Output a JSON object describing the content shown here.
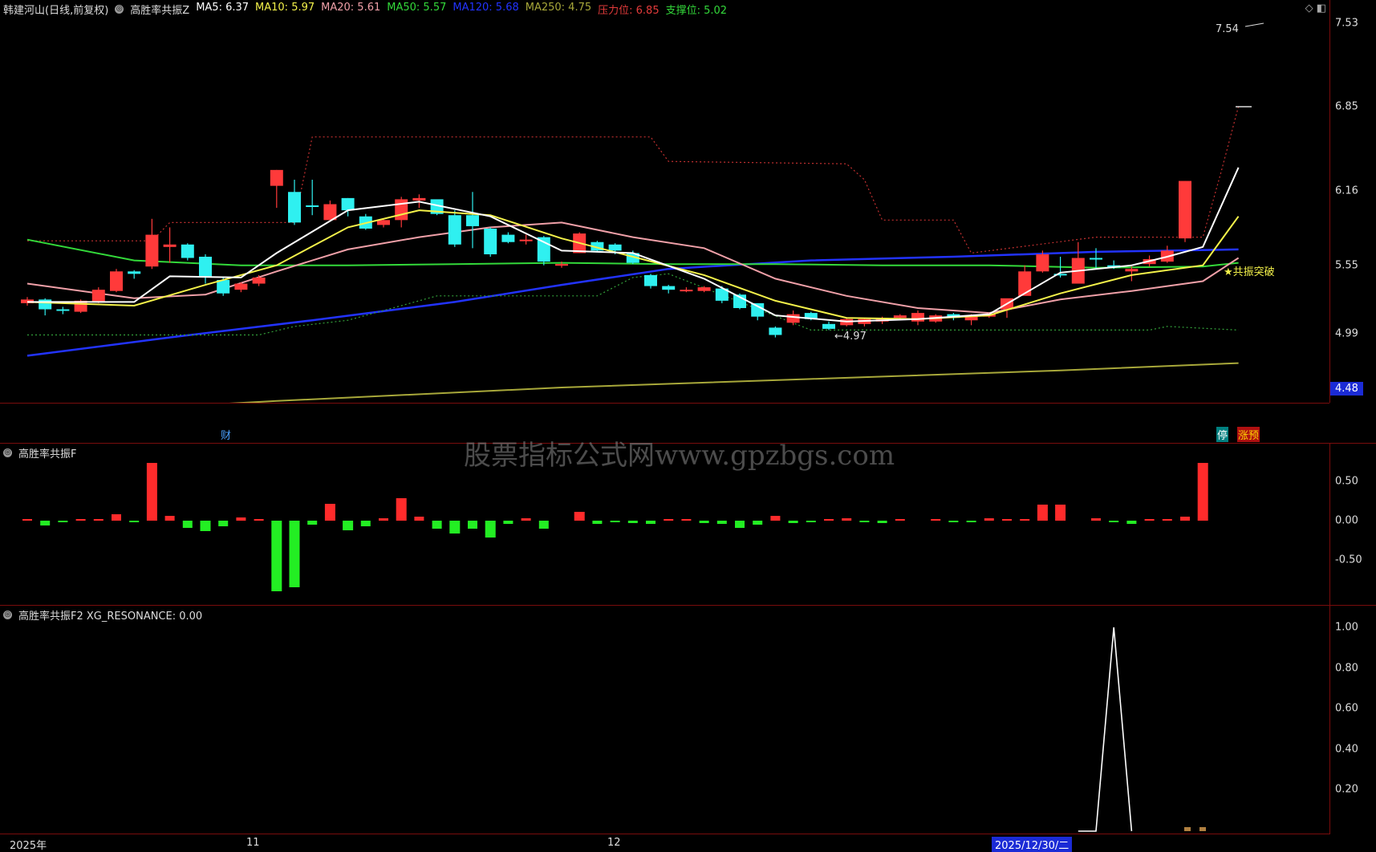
{
  "main_header": {
    "stock": "韩建河山(日线,前复权)",
    "indicator": "高胜率共振Z",
    "items": [
      {
        "label": "MA5: 6.37",
        "color": "#ffffff"
      },
      {
        "label": "MA10: 5.97",
        "color": "#f4f24a"
      },
      {
        "label": "MA20: 5.61",
        "color": "#f0a0a8"
      },
      {
        "label": "MA50: 5.57",
        "color": "#33d93a"
      },
      {
        "label": "MA120: 5.68",
        "color": "#2233ff"
      },
      {
        "label": "MA250: 4.75",
        "color": "#a8a83a"
      },
      {
        "label": "压力位: 6.85",
        "color": "#e43b3b"
      },
      {
        "label": "支撑位: 5.02",
        "color": "#33d93a"
      }
    ]
  },
  "price_axis": [
    "7.53",
    "6.85",
    "6.16",
    "5.55",
    "4.99"
  ],
  "price_box": "4.48",
  "annotations": {
    "high": "7.54",
    "low": "4.97",
    "resonance": "★共振突破",
    "fin": "财",
    "stop": "停",
    "limit_warn": "涨预"
  },
  "watermark": "股票指标公式网www.gpzbgs.com",
  "panel2_header": "高胜率共振F",
  "panel2_axis": [
    "0.50",
    "0.00",
    "-0.50"
  ],
  "panel3_header": "高胜率共振F2  XG_RESONANCE: 0.00",
  "panel3_axis": [
    "1.00",
    "0.80",
    "0.60",
    "0.40",
    "0.20"
  ],
  "date_axis": [
    "2025年",
    "11",
    "12",
    "2025/12/30/二"
  ],
  "colors": {
    "up": "#ff3a3a",
    "down": "#2ff0f0",
    "grid_border": "#7a0c0c"
  },
  "chart_data": {
    "type": "candlestick",
    "candles": [
      [
        5.24,
        5.27,
        5.22,
        5.29
      ],
      [
        5.27,
        5.19,
        5.14,
        5.28
      ],
      [
        5.19,
        5.18,
        5.15,
        5.21
      ],
      [
        5.17,
        5.26,
        5.16,
        5.27
      ],
      [
        5.25,
        5.35,
        5.24,
        5.37
      ],
      [
        5.34,
        5.5,
        5.33,
        5.52
      ],
      [
        5.5,
        5.48,
        5.44,
        5.51
      ],
      [
        5.54,
        5.8,
        5.52,
        5.93
      ],
      [
        5.7,
        5.72,
        5.57,
        5.86
      ],
      [
        5.72,
        5.61,
        5.59,
        5.73
      ],
      [
        5.62,
        5.45,
        5.4,
        5.64
      ],
      [
        5.43,
        5.32,
        5.3,
        5.45
      ],
      [
        5.35,
        5.4,
        5.33,
        5.41
      ],
      [
        5.4,
        5.45,
        5.38,
        5.47
      ],
      [
        6.2,
        6.33,
        6.02,
        6.33
      ],
      [
        6.15,
        5.9,
        5.88,
        6.25
      ],
      [
        6.04,
        6.03,
        5.96,
        6.25
      ],
      [
        5.92,
        6.05,
        5.96,
        6.08
      ],
      [
        6.1,
        6.0,
        5.95,
        6.1
      ],
      [
        5.95,
        5.85,
        5.84,
        5.97
      ],
      [
        5.88,
        5.92,
        5.86,
        5.93
      ],
      [
        5.92,
        6.09,
        5.86,
        6.11
      ],
      [
        6.08,
        6.1,
        6.02,
        6.13
      ],
      [
        6.09,
        5.97,
        5.96,
        6.08
      ],
      [
        5.96,
        5.72,
        5.7,
        6.0
      ],
      [
        5.96,
        5.87,
        5.69,
        6.15
      ],
      [
        5.85,
        5.64,
        5.62,
        5.86
      ],
      [
        5.8,
        5.74,
        5.73,
        5.82
      ],
      [
        5.75,
        5.76,
        5.72,
        5.8
      ],
      [
        5.78,
        5.58,
        5.55,
        5.79
      ],
      [
        5.55,
        5.56,
        5.53,
        5.58
      ],
      [
        5.65,
        5.81,
        5.65,
        5.82
      ],
      [
        5.74,
        5.67,
        5.66,
        5.75
      ],
      [
        5.72,
        5.67,
        5.64,
        5.73
      ],
      [
        5.65,
        5.57,
        5.56,
        5.67
      ],
      [
        5.47,
        5.38,
        5.36,
        5.48
      ],
      [
        5.38,
        5.35,
        5.32,
        5.39
      ],
      [
        5.35,
        5.35,
        5.33,
        5.37
      ],
      [
        5.34,
        5.37,
        5.33,
        5.38
      ],
      [
        5.36,
        5.26,
        5.24,
        5.38
      ],
      [
        5.31,
        5.2,
        5.19,
        5.32
      ],
      [
        5.24,
        5.13,
        5.1,
        5.24
      ],
      [
        5.04,
        4.98,
        4.96,
        5.05
      ],
      [
        5.08,
        5.15,
        5.06,
        5.18
      ],
      [
        5.16,
        5.11,
        5.1,
        5.17
      ],
      [
        5.07,
        5.03,
        5.02,
        5.09
      ],
      [
        5.06,
        5.11,
        5.05,
        5.12
      ],
      [
        5.07,
        5.11,
        5.05,
        5.12
      ],
      [
        5.09,
        5.12,
        5.07,
        5.13
      ],
      [
        5.12,
        5.14,
        5.1,
        5.15
      ],
      [
        5.09,
        5.16,
        5.06,
        5.18
      ],
      [
        5.09,
        5.14,
        5.08,
        5.15
      ],
      [
        5.15,
        5.12,
        5.1,
        5.16
      ],
      [
        5.1,
        5.14,
        5.06,
        5.15
      ],
      [
        5.13,
        5.15,
        5.12,
        5.16
      ],
      [
        5.19,
        5.28,
        5.12,
        5.18
      ],
      [
        5.3,
        5.5,
        5.31,
        5.55
      ],
      [
        5.5,
        5.64,
        5.49,
        5.67
      ],
      [
        5.48,
        5.47,
        5.45,
        5.62
      ],
      [
        5.4,
        5.61,
        5.61,
        5.74
      ],
      [
        5.61,
        5.6,
        5.52,
        5.69
      ],
      [
        5.55,
        5.53,
        5.52,
        5.59
      ],
      [
        5.5,
        5.52,
        5.42,
        5.54
      ],
      [
        5.56,
        5.6,
        5.54,
        5.63
      ],
      [
        5.58,
        5.67,
        5.57,
        5.71
      ],
      [
        5.77,
        6.24,
        5.74,
        6.24
      ]
    ],
    "ma5": [
      [
        0,
        5.25
      ],
      [
        6,
        5.25
      ],
      [
        8,
        5.46
      ],
      [
        12,
        5.45
      ],
      [
        14,
        5.65
      ],
      [
        18,
        6.0
      ],
      [
        22,
        6.07
      ],
      [
        26,
        5.95
      ],
      [
        30,
        5.67
      ],
      [
        34,
        5.65
      ],
      [
        38,
        5.44
      ],
      [
        42,
        5.14
      ],
      [
        46,
        5.09
      ],
      [
        50,
        5.11
      ],
      [
        54,
        5.15
      ],
      [
        58,
        5.49
      ],
      [
        62,
        5.55
      ],
      [
        64,
        5.62
      ],
      [
        66,
        5.7
      ],
      [
        68,
        6.35
      ]
    ],
    "ma10": [
      [
        0,
        5.25
      ],
      [
        6,
        5.22
      ],
      [
        10,
        5.39
      ],
      [
        14,
        5.55
      ],
      [
        18,
        5.86
      ],
      [
        22,
        6.0
      ],
      [
        26,
        5.96
      ],
      [
        30,
        5.77
      ],
      [
        34,
        5.62
      ],
      [
        38,
        5.47
      ],
      [
        42,
        5.26
      ],
      [
        46,
        5.12
      ],
      [
        50,
        5.11
      ],
      [
        54,
        5.14
      ],
      [
        58,
        5.32
      ],
      [
        62,
        5.47
      ],
      [
        66,
        5.55
      ],
      [
        68,
        5.95
      ]
    ],
    "ma20": [
      [
        0,
        5.4
      ],
      [
        6,
        5.28
      ],
      [
        10,
        5.31
      ],
      [
        14,
        5.5
      ],
      [
        18,
        5.68
      ],
      [
        22,
        5.78
      ],
      [
        26,
        5.86
      ],
      [
        30,
        5.9
      ],
      [
        34,
        5.78
      ],
      [
        38,
        5.69
      ],
      [
        42,
        5.44
      ],
      [
        46,
        5.3
      ],
      [
        50,
        5.2
      ],
      [
        54,
        5.16
      ],
      [
        58,
        5.27
      ],
      [
        62,
        5.34
      ],
      [
        66,
        5.42
      ],
      [
        68,
        5.61
      ]
    ],
    "ma50": [
      [
        0,
        5.76
      ],
      [
        6,
        5.59
      ],
      [
        12,
        5.55
      ],
      [
        18,
        5.55
      ],
      [
        24,
        5.56
      ],
      [
        30,
        5.57
      ],
      [
        36,
        5.56
      ],
      [
        42,
        5.56
      ],
      [
        48,
        5.55
      ],
      [
        54,
        5.55
      ],
      [
        60,
        5.53
      ],
      [
        66,
        5.54
      ],
      [
        68,
        5.57
      ]
    ],
    "ma120": [
      [
        0,
        4.81
      ],
      [
        8,
        4.96
      ],
      [
        16,
        5.1
      ],
      [
        24,
        5.25
      ],
      [
        30,
        5.39
      ],
      [
        36,
        5.52
      ],
      [
        44,
        5.59
      ],
      [
        52,
        5.62
      ],
      [
        60,
        5.66
      ],
      [
        68,
        5.68
      ]
    ],
    "ma250": [
      [
        0,
        4.33
      ],
      [
        14,
        4.44
      ],
      [
        30,
        4.55
      ],
      [
        44,
        4.62
      ],
      [
        58,
        4.69
      ],
      [
        68,
        4.75
      ]
    ],
    "pressure": [
      [
        0,
        5.75
      ],
      [
        7,
        5.75
      ],
      [
        8,
        5.9
      ],
      [
        15,
        5.9
      ],
      [
        16,
        6.6
      ],
      [
        35,
        6.6
      ],
      [
        36,
        6.4
      ],
      [
        46,
        6.38
      ],
      [
        47,
        6.25
      ],
      [
        48,
        5.92
      ],
      [
        52,
        5.92
      ],
      [
        53,
        5.65
      ],
      [
        60,
        5.78
      ],
      [
        66,
        5.78
      ],
      [
        67,
        6.3
      ],
      [
        68,
        6.85
      ]
    ],
    "support": [
      [
        0,
        4.98
      ],
      [
        13,
        4.98
      ],
      [
        15,
        5.05
      ],
      [
        18,
        5.1
      ],
      [
        23,
        5.3
      ],
      [
        32,
        5.3
      ],
      [
        34,
        5.45
      ],
      [
        36,
        5.48
      ],
      [
        44,
        5.02
      ],
      [
        63,
        5.02
      ],
      [
        64,
        5.05
      ],
      [
        68,
        5.02
      ]
    ],
    "bars_f": [
      0.01,
      -0.06,
      -0.01,
      0.02,
      0.02,
      0.08,
      -0.01,
      0.72,
      0.06,
      -0.09,
      -0.13,
      -0.07,
      0.04,
      0.01,
      -0.88,
      -0.83,
      -0.05,
      0.21,
      -0.12,
      -0.07,
      0.03,
      0.28,
      0.05,
      -0.1,
      -0.16,
      -0.1,
      -0.21,
      -0.04,
      0.03,
      -0.1,
      0.0,
      0.11,
      -0.04,
      -0.01,
      -0.03,
      -0.04,
      0.02,
      0.01,
      -0.03,
      -0.04,
      -0.09,
      -0.05,
      0.06,
      -0.03,
      -0.02,
      0.02,
      0.03,
      -0.02,
      -0.03,
      0.01,
      0.0,
      0.01,
      -0.01,
      -0.01,
      0.03,
      0.01,
      0.01,
      0.2,
      0.2,
      0.0,
      0.03,
      -0.01,
      -0.04,
      0.02,
      0.02,
      0.05,
      0.72
    ],
    "xg_resonance": [
      [
        59,
        0
      ],
      [
        60,
        0
      ],
      [
        61,
        1
      ],
      [
        62,
        0
      ]
    ]
  }
}
